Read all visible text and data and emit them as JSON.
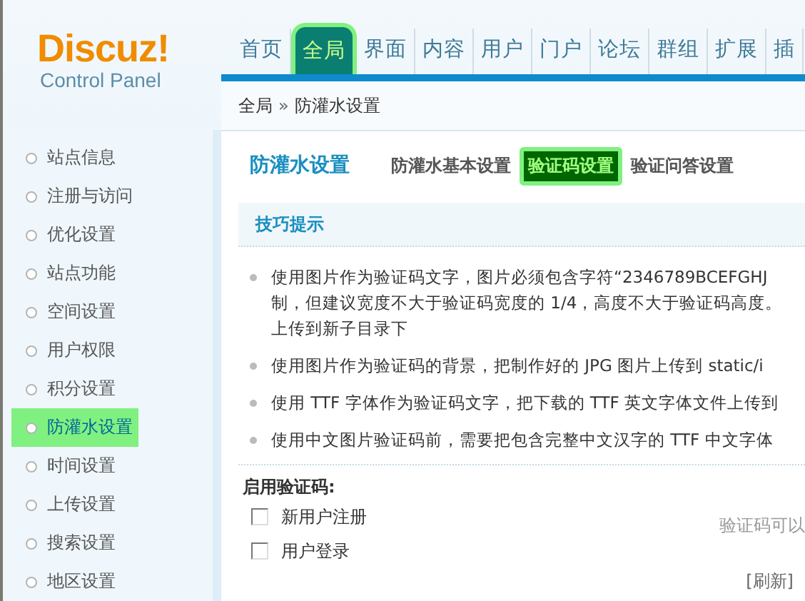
{
  "logo": {
    "title": "Discuz!",
    "subtitle": "Control Panel"
  },
  "nav": [
    {
      "label": "首页",
      "selected": false
    },
    {
      "label": "全局",
      "selected": true
    },
    {
      "label": "界面",
      "selected": false
    },
    {
      "label": "内容",
      "selected": false
    },
    {
      "label": "用户",
      "selected": false
    },
    {
      "label": "门户",
      "selected": false
    },
    {
      "label": "论坛",
      "selected": false
    },
    {
      "label": "群组",
      "selected": false
    },
    {
      "label": "扩展",
      "selected": false
    },
    {
      "label": "插",
      "selected": false
    }
  ],
  "breadcrumb": {
    "items": [
      "全局",
      "防灌水设置"
    ],
    "separator": "»"
  },
  "sidebar": {
    "items": [
      {
        "label": "站点信息",
        "selected": false
      },
      {
        "label": "注册与访问",
        "selected": false
      },
      {
        "label": "优化设置",
        "selected": false
      },
      {
        "label": "站点功能",
        "selected": false
      },
      {
        "label": "空间设置",
        "selected": false
      },
      {
        "label": "用户权限",
        "selected": false
      },
      {
        "label": "积分设置",
        "selected": false
      },
      {
        "label": "防灌水设置",
        "selected": true
      },
      {
        "label": "时间设置",
        "selected": false
      },
      {
        "label": "上传设置",
        "selected": false
      },
      {
        "label": "搜索设置",
        "selected": false
      },
      {
        "label": "地区设置",
        "selected": false
      }
    ]
  },
  "page_title": "防灌水设置",
  "subtabs": [
    {
      "label": "防灌水基本设置",
      "selected": false
    },
    {
      "label": "验证码设置",
      "selected": true
    },
    {
      "label": "验证问答设置",
      "selected": false
    }
  ],
  "tips": {
    "title": "技巧提示",
    "items": [
      [
        "使用图片作为验证码文字，图片必须包含字符“2346789BCEFGHJ",
        "制，但建议宽度不大于验证码宽度的 1/4，高度不大于验证码高度。",
        "上传到新子目录下"
      ],
      [
        "使用图片作为验证码的背景，把制作好的 JPG 图片上传到 static/i"
      ],
      [
        "使用 TTF 字体作为验证码文字，把下载的 TTF 英文字体文件上传到"
      ],
      [
        "使用中文图片验证码前，需要把包含完整中文汉字的 TTF 中文字体"
      ]
    ]
  },
  "captcha": {
    "label": "启用验证码:",
    "options": [
      {
        "label": "新用户注册",
        "checked": false
      },
      {
        "label": "用户登录",
        "checked": false
      }
    ],
    "hint": "验证码可以",
    "refresh": "[刷新]"
  }
}
